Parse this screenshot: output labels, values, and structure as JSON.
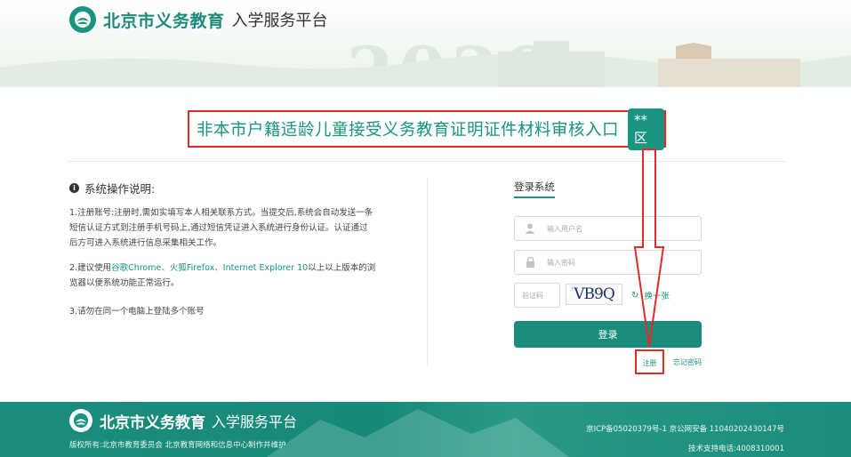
{
  "header": {
    "brand_name": "北京市义务教育",
    "brand_sub": "入学服务平台",
    "watermark_year": "2020"
  },
  "title": {
    "text": "非本市户籍适龄儿童接受义务教育证明证件材料审核入口",
    "district": "**区"
  },
  "instructions": {
    "heading": "系统操作说明:",
    "p1": "1.注册账号:注册时,需如实填写本人相关联系方式。当提交后,系统会自动发送一条短信认证方式到注册手机号码上,通过短信凭证进入系统进行身份认证。认证通过后方可进入系统进行信息采集相关工作。",
    "p2_before": "2.建议使用",
    "p2_link": "谷歌Chrome、火狐Firefox、Internet Explorer 10",
    "p2_after": "以上以上版本的浏览器以便系统功能正常运行。",
    "p3": "3.请勿在同一个电脑上登陆多个账号"
  },
  "login": {
    "title": "登录系统",
    "username_placeholder": "输入用户名",
    "password_placeholder": "输入密码",
    "captcha_placeholder": "验证码",
    "captcha_text": "VB9Q",
    "captcha_mark": "'",
    "refresh_label": "换一张",
    "submit_label": "登录",
    "register_label": "注册",
    "forgot_label": "忘记密码"
  },
  "footer": {
    "brand_name": "北京市义务教育",
    "brand_sub": "入学服务平台",
    "copyright": "版权所有:北京市教育委员会 北京教育网络和信息中心制作并维护",
    "icp": "京ICP备05020379号-1 京公网安备 11040202430147号",
    "support": "技术支持电话:4008310001"
  },
  "colors": {
    "brand": "#189481",
    "annotation": "#e32a2a"
  }
}
